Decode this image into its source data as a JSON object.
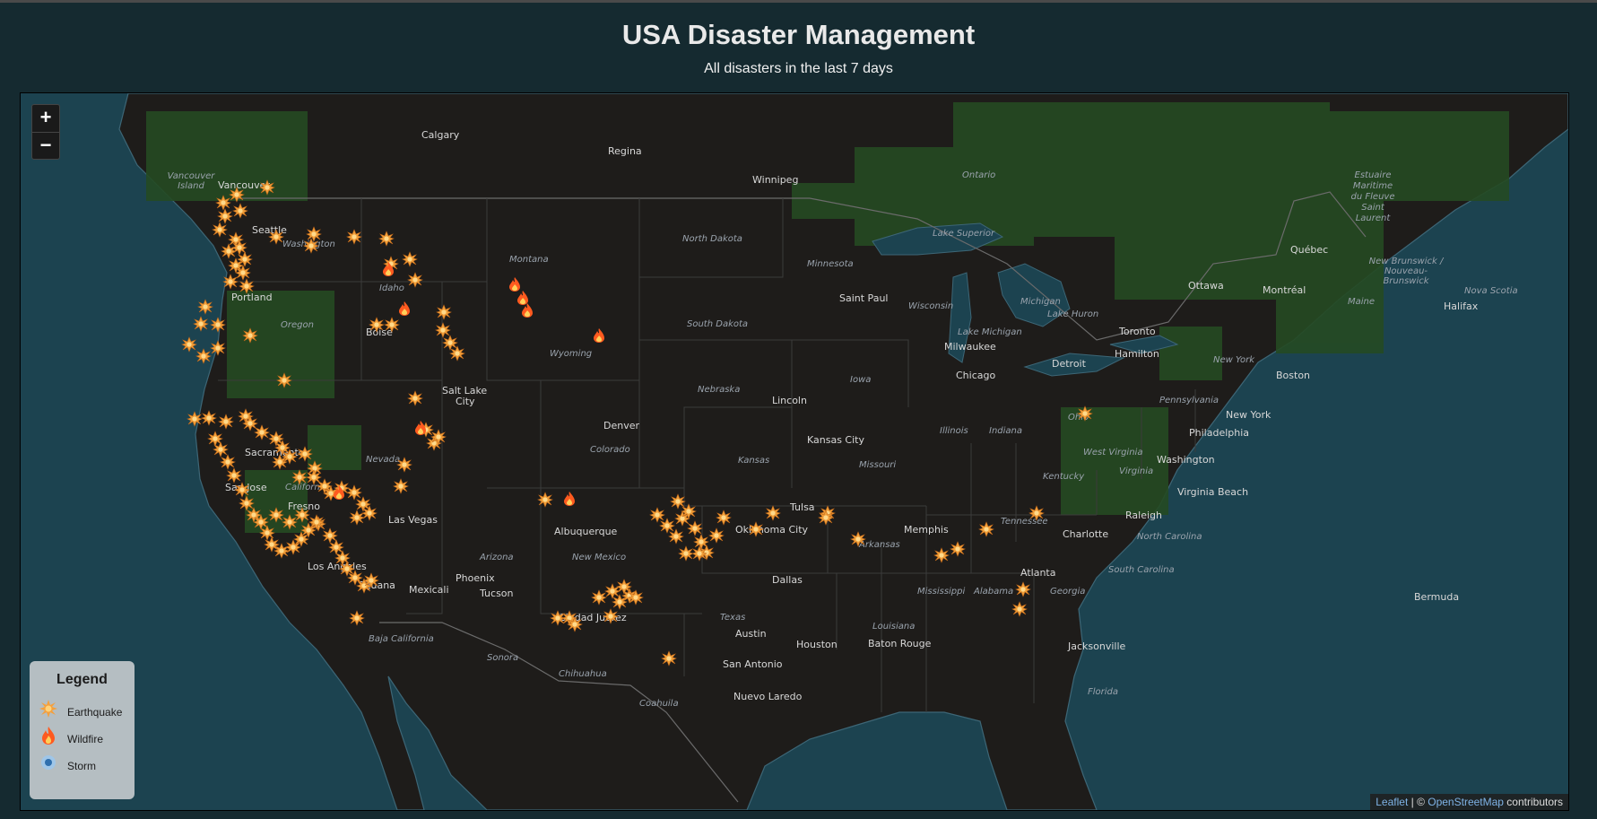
{
  "header": {
    "title": "USA Disaster Management",
    "subtitle": "All disasters in the last 7 days"
  },
  "zoom": {
    "in_label": "+",
    "out_label": "−"
  },
  "legend": {
    "title": "Legend",
    "items": [
      {
        "label": "Earthquake",
        "icon": "earthquake-icon",
        "color": "#ffb347"
      },
      {
        "label": "Wildfire",
        "icon": "wildfire-icon",
        "color": "#ff6b2e"
      },
      {
        "label": "Storm",
        "icon": "storm-icon",
        "color": "#4a8fd6"
      }
    ]
  },
  "attribution": {
    "leaflet": "Leaflet",
    "separator": " | © ",
    "osm": "OpenStreetMap",
    "suffix": " contributors"
  },
  "colors": {
    "background": "#152a30",
    "water": "#1c4350",
    "land": "#1d1b19",
    "forest": "#254a22",
    "earthquake": "#ffb347",
    "wildfire": "#ff6b2e"
  },
  "map_labels": {
    "cities": [
      "Calgary",
      "Regina",
      "Winnipeg",
      "Vancouver",
      "Seattle",
      "Portland",
      "Boise",
      "Salt Lake City",
      "Sacramento",
      "San Jose",
      "Fresno",
      "Las Vegas",
      "Los Angeles",
      "Tijuana",
      "Mexicali",
      "Phoenix",
      "Tucson",
      "Albuquerque",
      "Denver",
      "Lincoln",
      "Kansas City",
      "Tulsa",
      "Oklahoma City",
      "Dallas",
      "Austin",
      "San Antonio",
      "Houston",
      "Memphis",
      "Saint Paul",
      "Milwaukee",
      "Chicago",
      "Detroit",
      "Toronto",
      "Hamilton",
      "Ottawa",
      "Montréal",
      "Québec",
      "Halifax",
      "Boston",
      "New York",
      "Philadelphia",
      "Washington",
      "Virginia Beach",
      "Raleigh",
      "Charlotte",
      "Atlanta",
      "Jacksonville",
      "Baton Rouge",
      "Ciudad Juárez",
      "Nuevo Laredo",
      "Bermuda"
    ],
    "regions": [
      "Vancouver Island",
      "Washington",
      "Oregon",
      "Idaho",
      "Montana",
      "Wyoming",
      "Nevada",
      "California",
      "Arizona",
      "New Mexico",
      "Colorado",
      "North Dakota",
      "South Dakota",
      "Nebraska",
      "Kansas",
      "Minnesota",
      "Iowa",
      "Missouri",
      "Wisconsin",
      "Illinois",
      "Indiana",
      "Michigan",
      "Ohio",
      "Kentucky",
      "Tennessee",
      "Arkansas",
      "Mississippi",
      "Alabama",
      "Georgia",
      "Texas",
      "Louisiana",
      "Florida",
      "North Carolina",
      "South Carolina",
      "West Virginia",
      "Virginia",
      "Pennsylvania",
      "New York",
      "Ontario",
      "Maine",
      "Lake Superior",
      "Lake Michigan",
      "Lake Huron",
      "Baja California",
      "Sonora",
      "Chihuahua",
      "Coahuila",
      "Estuaire Maritime du Fleuve Saint Laurent",
      "New Brunswick / Nouveau-Brunswick",
      "Nova Scotia"
    ]
  }
}
